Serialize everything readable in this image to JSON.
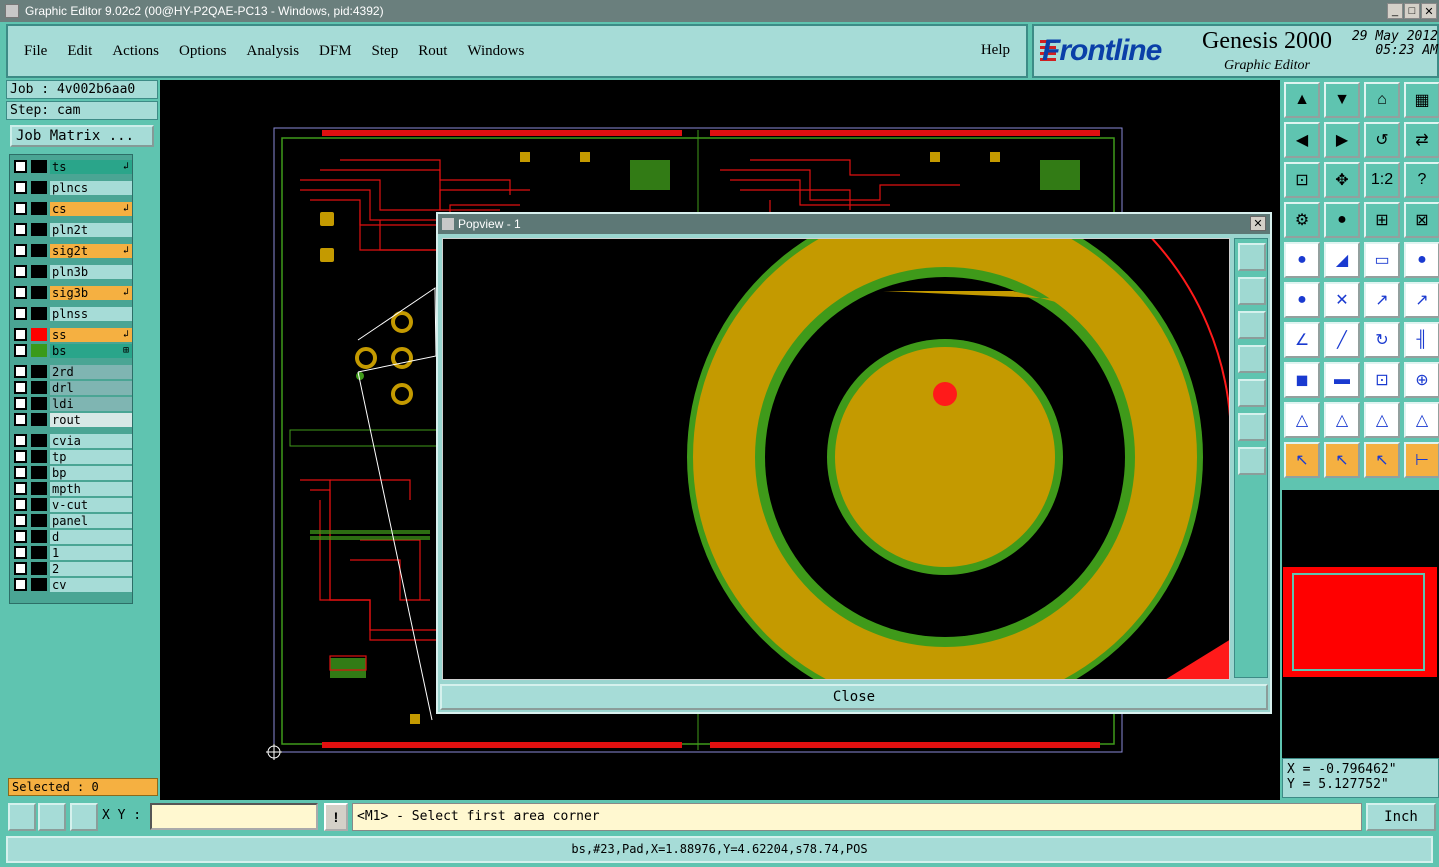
{
  "window": {
    "title": "Graphic Editor 9.02c2 (00@HY-P2QAE-PC13 - Windows, pid:4392)"
  },
  "menu": [
    "File",
    "Edit",
    "Actions",
    "Options",
    "Analysis",
    "DFM",
    "Step",
    "Rout",
    "Windows"
  ],
  "help_label": "Help",
  "brand": {
    "logo": "Frontline",
    "product": "Genesis 2000",
    "subtitle": "Graphic Editor",
    "date": "29 May 2012",
    "time": "05:23 AM"
  },
  "job": {
    "job_line": "Job : 4v002b6aa0",
    "step_line": "Step: cam",
    "matrix_button": "Job Matrix ..."
  },
  "layers": [
    {
      "name": "ts",
      "bg": "#2aa58a",
      "swatch": "#000000",
      "mark": "↲"
    },
    {
      "name": "plncs",
      "bg": "#a6dcd7",
      "swatch": "#000000",
      "mark": ""
    },
    {
      "name": "cs",
      "bg": "#f5b041",
      "swatch": "#000000",
      "mark": "↲"
    },
    {
      "name": "pln2t",
      "bg": "#a6dcd7",
      "swatch": "#000000",
      "mark": ""
    },
    {
      "name": "sig2t",
      "bg": "#f5b041",
      "swatch": "#000000",
      "mark": "↲"
    },
    {
      "name": "pln3b",
      "bg": "#a6dcd7",
      "swatch": "#000000",
      "mark": ""
    },
    {
      "name": "sig3b",
      "bg": "#f5b041",
      "swatch": "#000000",
      "mark": "↲"
    },
    {
      "name": "plnss",
      "bg": "#a6dcd7",
      "swatch": "#000000",
      "mark": ""
    },
    {
      "name": "ss",
      "bg": "#f5b041",
      "swatch": "#ff0000",
      "mark": "↲"
    },
    {
      "name": "bs",
      "bg": "#2aa58a",
      "swatch": "#3a9a1a",
      "mark": "⊞"
    },
    {
      "name": "2rd",
      "bg": "#7fb5b2",
      "swatch": "#000000",
      "mark": ""
    },
    {
      "name": "drl",
      "bg": "#7fb5b2",
      "swatch": "#000000",
      "mark": ""
    },
    {
      "name": "ldi",
      "bg": "#7fb5b2",
      "swatch": "#000000",
      "mark": ""
    },
    {
      "name": "rout",
      "bg": "#d8e8e6",
      "swatch": "#000000",
      "mark": ""
    },
    {
      "name": "cvia",
      "bg": "#a6dcd7",
      "swatch": "#000000",
      "mark": ""
    },
    {
      "name": "tp",
      "bg": "#a6dcd7",
      "swatch": "#000000",
      "mark": ""
    },
    {
      "name": "bp",
      "bg": "#a6dcd7",
      "swatch": "#000000",
      "mark": ""
    },
    {
      "name": "mpth",
      "bg": "#a6dcd7",
      "swatch": "#000000",
      "mark": ""
    },
    {
      "name": "v-cut",
      "bg": "#a6dcd7",
      "swatch": "#000000",
      "mark": ""
    },
    {
      "name": "panel",
      "bg": "#a6dcd7",
      "swatch": "#000000",
      "mark": ""
    },
    {
      "name": "d",
      "bg": "#a6dcd7",
      "swatch": "#000000",
      "mark": ""
    },
    {
      "name": "1",
      "bg": "#a6dcd7",
      "swatch": "#000000",
      "mark": ""
    },
    {
      "name": "2",
      "bg": "#a6dcd7",
      "swatch": "#000000",
      "mark": ""
    },
    {
      "name": "cv",
      "bg": "#a6dcd7",
      "swatch": "#000000",
      "mark": ""
    }
  ],
  "selected_text": "Selected : 0",
  "popup": {
    "title": "Popview - 1",
    "close_label": "Close"
  },
  "coords": {
    "x": "X = -0.796462\"",
    "y": "Y = 5.127752\""
  },
  "bottom": {
    "xy_label": "X Y :",
    "xy_value": "",
    "prompt": "<M1> - Select first area corner",
    "unit": "Inch"
  },
  "status_text": "bs,#23,Pad,X=1.88976,Y=4.62204,s78.74,POS",
  "colors": {
    "copper_red": "#ff1a1a",
    "pad_gold": "#c49a00",
    "outline_green": "#3f9a1a",
    "panel_teal": "#5fc4b0"
  }
}
